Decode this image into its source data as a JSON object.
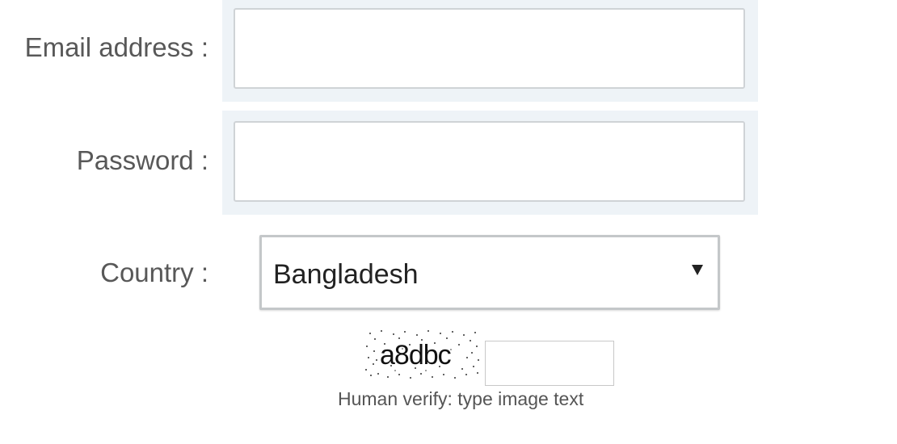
{
  "form": {
    "email": {
      "label": "Email address :",
      "value": ""
    },
    "password": {
      "label": "Password :",
      "value": ""
    },
    "country": {
      "label": "Country :",
      "selected": "Bangladesh"
    },
    "captcha": {
      "image_text": "a8dbc",
      "value": "",
      "hint": "Human verify: type image text"
    }
  },
  "icons": {
    "country_dropdown": "caret-down-icon"
  }
}
